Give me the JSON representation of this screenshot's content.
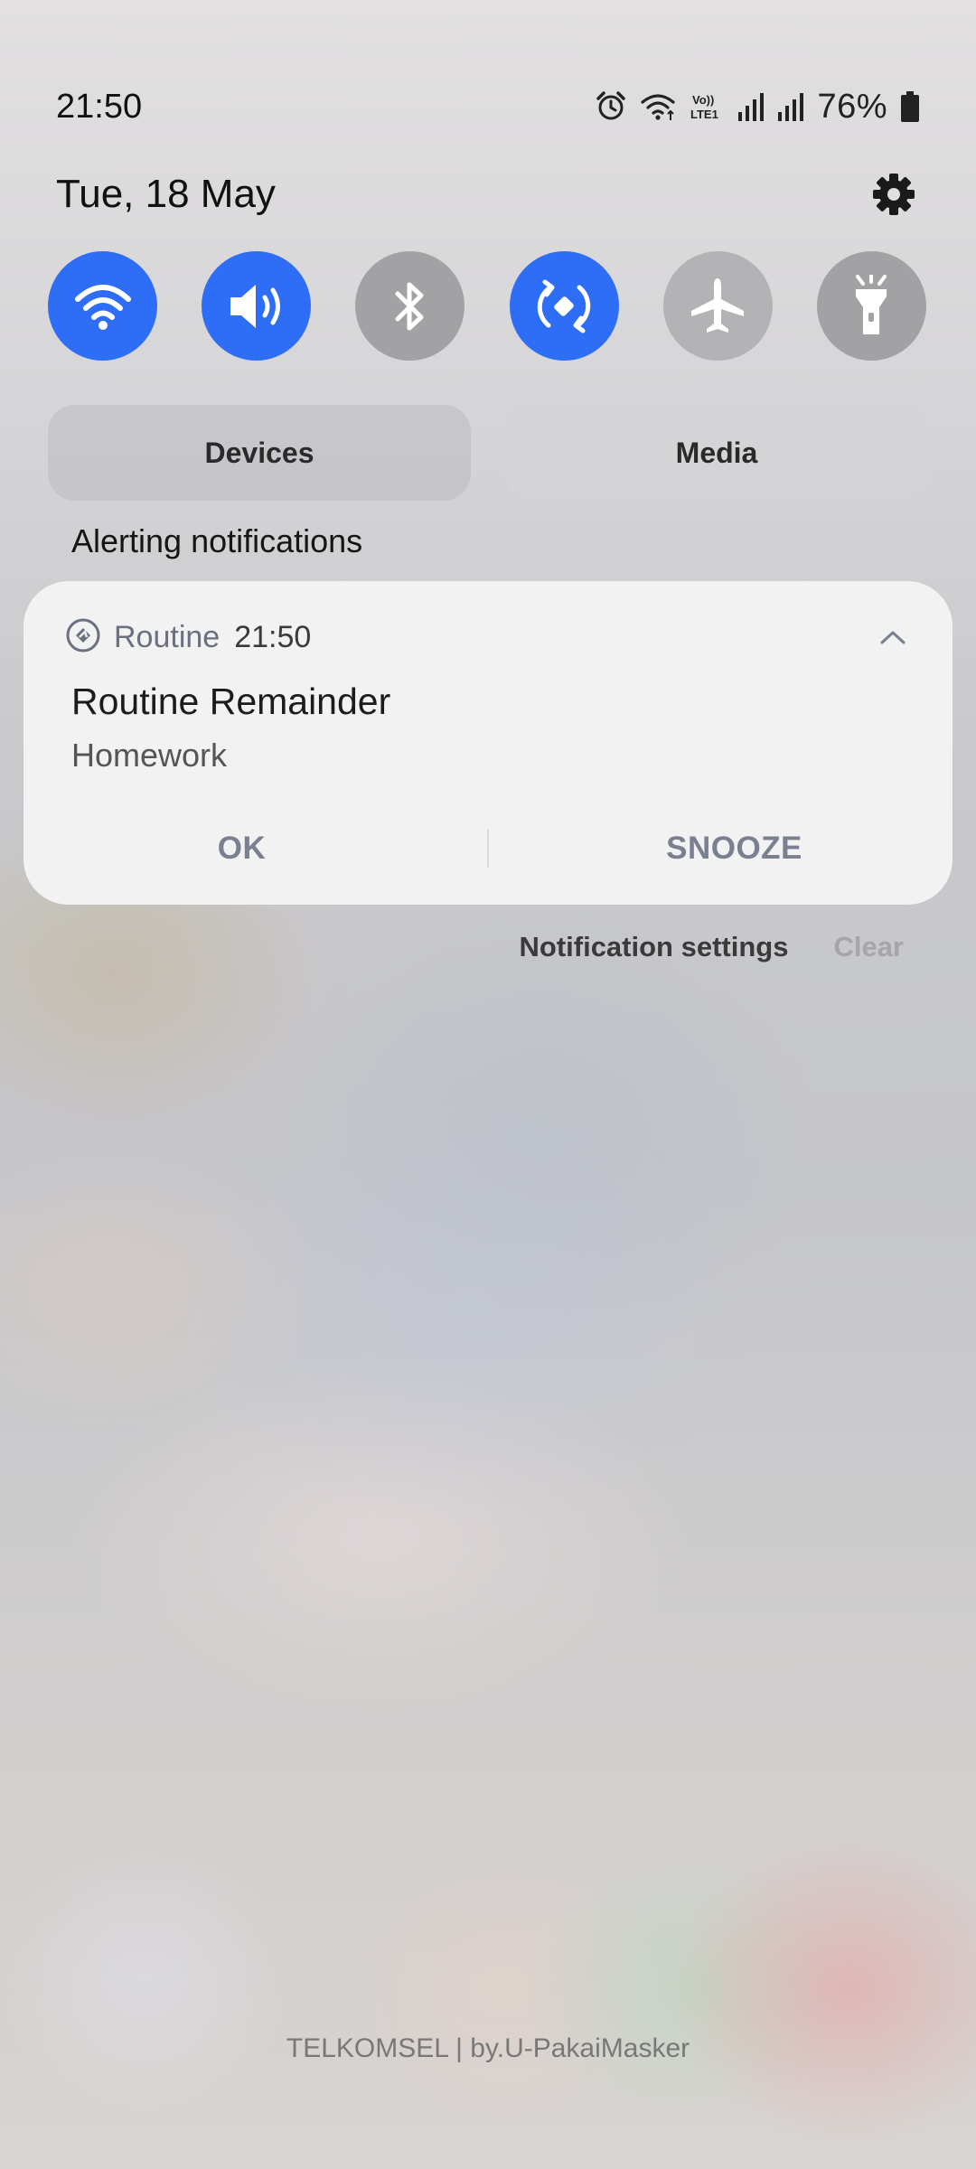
{
  "status_bar": {
    "time": "21:50",
    "battery": "76%",
    "icons": [
      "alarm-icon",
      "wifi-calling-icon",
      "volte-lte-icon",
      "signal-icon",
      "signal-icon",
      "battery-icon"
    ]
  },
  "header": {
    "date": "Tue, 18 May",
    "settings_icon": "gear-icon"
  },
  "quick_toggles": [
    {
      "icon": "wifi-icon",
      "state": "on"
    },
    {
      "icon": "sound-icon",
      "state": "on"
    },
    {
      "icon": "bluetooth-icon",
      "state": "off"
    },
    {
      "icon": "auto-rotate-icon",
      "state": "on"
    },
    {
      "icon": "airplane-icon",
      "state": "off"
    },
    {
      "icon": "flashlight-icon",
      "state": "off"
    }
  ],
  "panels": {
    "devices_label": "Devices",
    "media_label": "Media"
  },
  "section": {
    "label": "Alerting notifications"
  },
  "notification": {
    "app_name": "Routine",
    "time": "21:50",
    "title": "Routine Remainder",
    "text": "Homework",
    "actions": {
      "ok": "OK",
      "snooze": "SNOOZE"
    }
  },
  "footer": {
    "settings_label": "Notification settings",
    "clear_label": "Clear"
  },
  "carrier": "TELKOMSEL | by.U-PakaiMasker",
  "colors": {
    "accent": "#2E6EF7",
    "toggle_off": "#A2A2A5",
    "card_bg": "#F2F2F2"
  }
}
